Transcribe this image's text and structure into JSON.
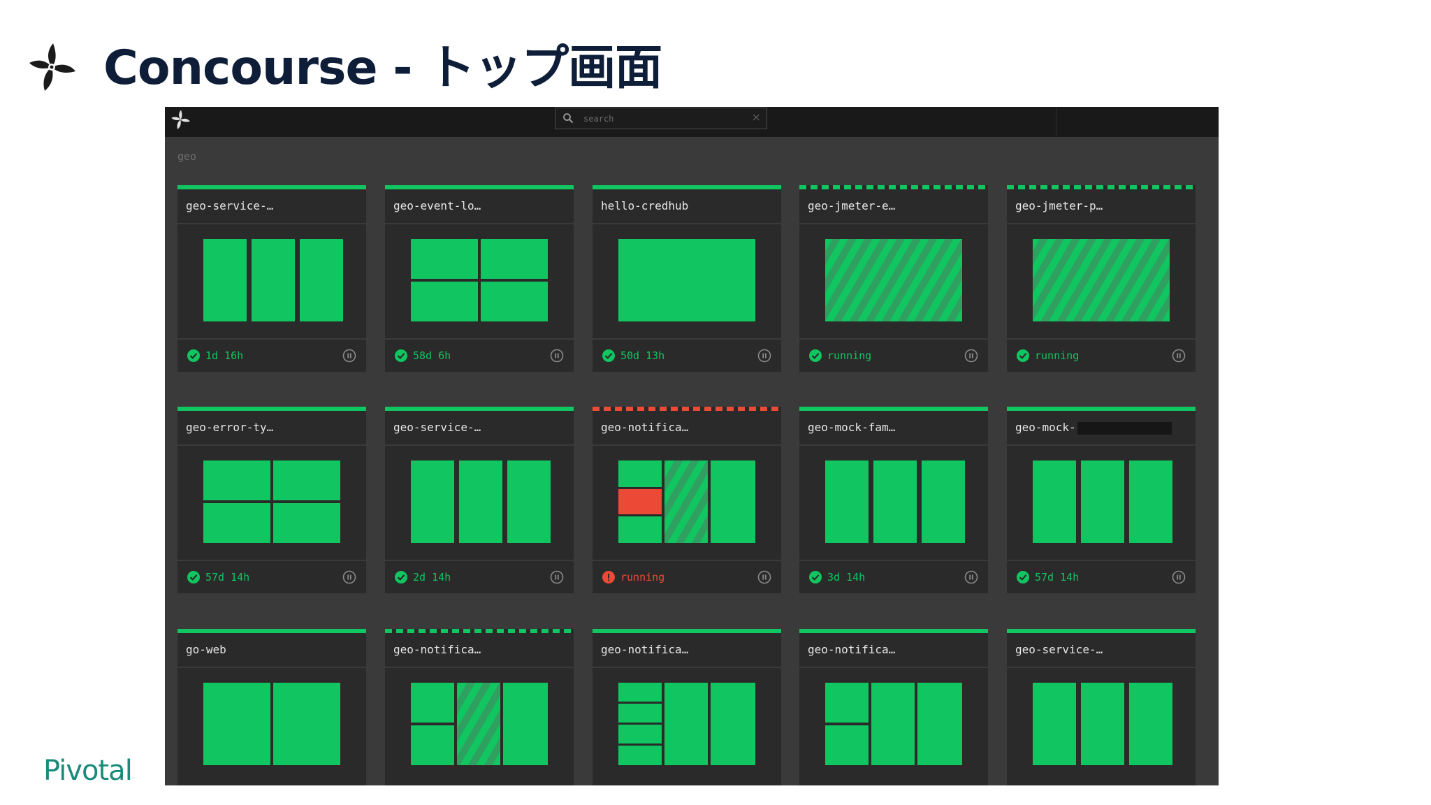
{
  "slide": {
    "title": "Concourse - トップ画面",
    "footer_brand": "Pivotal"
  },
  "app": {
    "search": {
      "placeholder": "search",
      "value": ""
    },
    "group_name": "geo",
    "status_colors": {
      "succeeded": "#11c560",
      "failed": "#ec4a36",
      "card": "#2a2a2a",
      "background": "#3a3a3a"
    },
    "pipelines": [
      {
        "name": "geo-service-…",
        "status": "succeeded",
        "bar": "solid",
        "time": "1d 16h"
      },
      {
        "name": "geo-event-lo…",
        "status": "succeeded",
        "bar": "solid",
        "time": "58d 6h"
      },
      {
        "name": "hello-credhub",
        "status": "succeeded",
        "bar": "solid",
        "time": "50d 13h"
      },
      {
        "name": "geo-jmeter-e…",
        "status": "succeeded",
        "bar": "striped",
        "time": "running"
      },
      {
        "name": "geo-jmeter-p…",
        "status": "succeeded",
        "bar": "striped",
        "time": "running"
      },
      {
        "name": "geo-error-ty…",
        "status": "succeeded",
        "bar": "solid",
        "time": "57d 14h"
      },
      {
        "name": "geo-service-…",
        "status": "succeeded",
        "bar": "solid",
        "time": "2d 14h"
      },
      {
        "name": "geo-notifica…",
        "status": "failed",
        "bar": "striped-red",
        "time": "running"
      },
      {
        "name": "geo-mock-fam…",
        "status": "succeeded",
        "bar": "solid",
        "time": "3d 14h"
      },
      {
        "name": "geo-mock-",
        "status": "succeeded",
        "bar": "solid",
        "time": "57d 14h"
      },
      {
        "name": "go-web",
        "status": "succeeded",
        "bar": "solid",
        "time": ""
      },
      {
        "name": "geo-notifica…",
        "status": "succeeded",
        "bar": "striped",
        "time": ""
      },
      {
        "name": "geo-notifica…",
        "status": "succeeded",
        "bar": "solid",
        "time": ""
      },
      {
        "name": "geo-notifica…",
        "status": "succeeded",
        "bar": "solid",
        "time": ""
      },
      {
        "name": "geo-service-…",
        "status": "succeeded",
        "bar": "solid",
        "time": ""
      }
    ]
  }
}
